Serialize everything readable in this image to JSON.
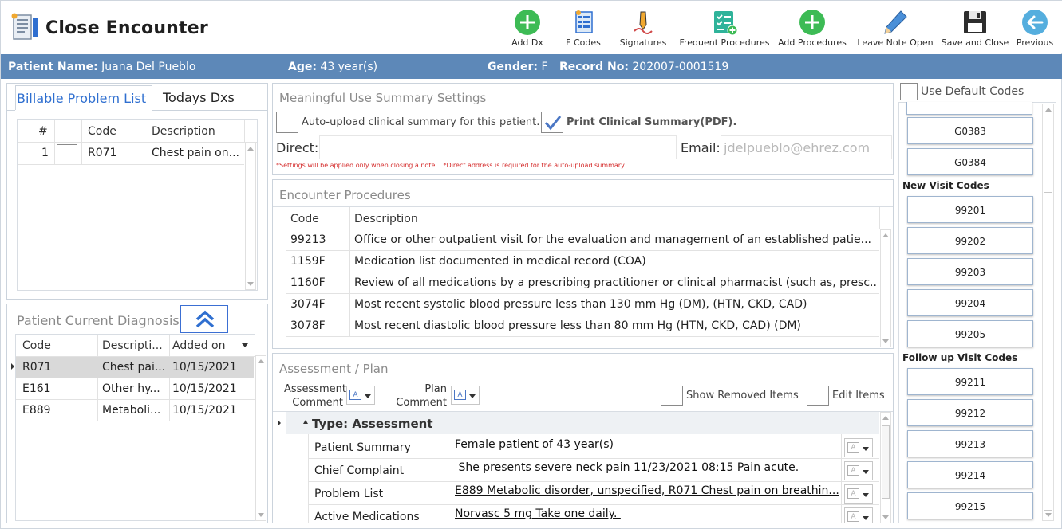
{
  "window": {
    "title": "Close Encounter"
  },
  "toolbar": [
    {
      "label": "Add Dx"
    },
    {
      "label": "F Codes"
    },
    {
      "label": "Signatures"
    },
    {
      "label": "Frequent Procedures"
    },
    {
      "label": "Add Procedures"
    },
    {
      "label": "Leave Note Open"
    },
    {
      "label": "Save and Close"
    },
    {
      "label": "Previous"
    }
  ],
  "patient": {
    "name_label": "Patient Name:",
    "name": "Juana Del Pueblo",
    "age_label": "Age:",
    "age": "43 year(s)",
    "gender_label": "Gender:",
    "gender": "F",
    "record_label": "Record No:",
    "record": "202007-0001519"
  },
  "problem_tabs": {
    "billable": "Billable Problem List",
    "todays": "Todays Dxs"
  },
  "problem_grid": {
    "headers": {
      "num": "#",
      "code": "Code",
      "desc": "Description"
    },
    "rows": [
      {
        "num": "1",
        "code": "R071",
        "desc": "Chest pain on..."
      }
    ]
  },
  "current_dx": {
    "title": "Patient Current Diagnosis",
    "headers": {
      "code": "Code",
      "desc": "Descripti...",
      "added": "Added on"
    },
    "rows": [
      {
        "code": "R071",
        "desc": "Chest pai...",
        "added": "10/15/2021"
      },
      {
        "code": "E161",
        "desc": "Other hy...",
        "added": "10/15/2021"
      },
      {
        "code": "E889",
        "desc": "Metaboli...",
        "added": "10/15/2021"
      }
    ]
  },
  "mu": {
    "title": "Meaningful Use Summary Settings",
    "auto_upload": "Auto-upload clinical summary for this patient.",
    "print_summary": "Print Clinical Summary(PDF).",
    "direct_label": "Direct:",
    "direct_value": "",
    "email_label": "Email:",
    "email_placeholder": "jdelpueblo@ehrez.com",
    "note": "*Settings will be applied only when closing a note.   *Direct address is required for the auto-upload summary."
  },
  "procedures": {
    "title": "Encounter Procedures",
    "headers": {
      "code": "Code",
      "desc": "Description"
    },
    "rows": [
      {
        "code": "99213",
        "desc": "Office or other outpatient visit for the evaluation and management of an established patie..."
      },
      {
        "code": "1159F",
        "desc": "Medication list documented in medical record (COA)"
      },
      {
        "code": "1160F",
        "desc": "Review of all medications by a prescribing practitioner or clinical pharmacist (such as, presc..."
      },
      {
        "code": "3074F",
        "desc": "Most recent systolic blood pressure less than 130 mm Hg (DM), (HTN, CKD, CAD)"
      },
      {
        "code": "3078F",
        "desc": "Most recent diastolic blood pressure less than 80 mm Hg (HTN, CKD, CAD) (DM)"
      }
    ]
  },
  "assessment": {
    "title": "Assessment / Plan",
    "assess_comment_1": "Assessment",
    "assess_comment_2": "Comment",
    "plan_comment_1": "Plan",
    "plan_comment_2": "Comment",
    "show_removed": "Show Removed Items",
    "edit_items": "Edit Items",
    "group": "Type: Assessment",
    "rows": [
      {
        "label": "Patient Summary",
        "value": "Female patient of 43 year(s)"
      },
      {
        "label": "Chief Complaint",
        "value": " She presents severe neck pain 11/23/2021 08:15 Pain acute. "
      },
      {
        "label": "Problem List",
        "value": "E889 Metabolic disorder, unspecified, R071 Chest pain on breathin..."
      },
      {
        "label": "Active Medications",
        "value": "Norvasc 5 mg Take one daily. "
      }
    ]
  },
  "codes": {
    "use_default": "Use Default Codes",
    "top": [
      "G0383",
      "G0384"
    ],
    "new_visit_title": "New Visit Codes",
    "new_visit": [
      "99201",
      "99202",
      "99203",
      "99204",
      "99205"
    ],
    "follow_up_title": "Follow up Visit Codes",
    "follow_up": [
      "99211",
      "99212",
      "99213",
      "99214",
      "99215"
    ]
  },
  "colors": {
    "patient_bar": "#5d88b8",
    "accent_green": "#3dbb55",
    "accent_blue": "#2f6fd0"
  }
}
